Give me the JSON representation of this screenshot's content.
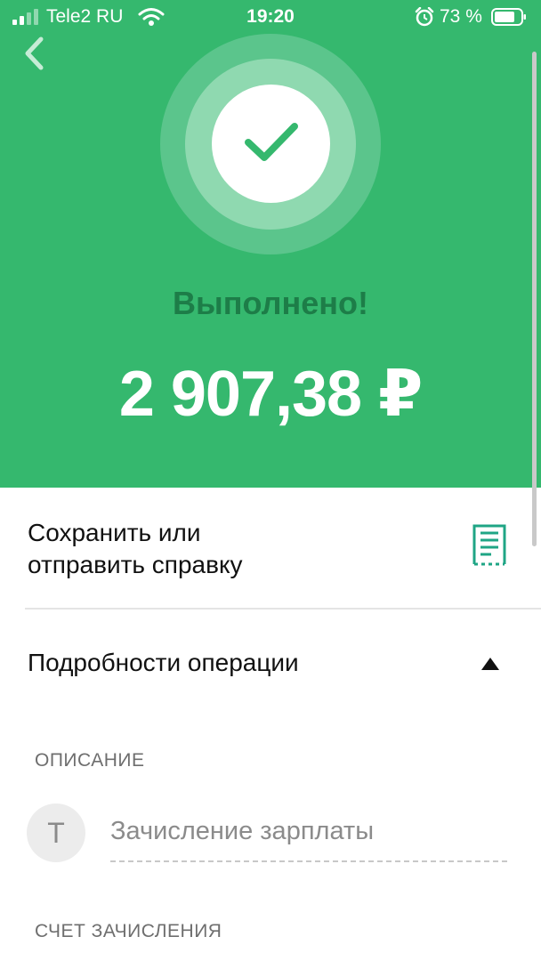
{
  "status_bar": {
    "carrier": "Tele2 RU",
    "time": "19:20",
    "battery": "73 %"
  },
  "result": {
    "status": "Выполнено!",
    "amount": "2 907,38 ₽"
  },
  "actions": {
    "save_receipt": "Сохранить или\nотправить справку",
    "details_toggle": "Подробности операции"
  },
  "details": {
    "description_label": "ОПИСАНИЕ",
    "avatar_letter": "Т",
    "description_value": "Зачисление зарплаты",
    "account_label": "СЧЕТ ЗАЧИСЛЕНИЯ"
  },
  "colors": {
    "hero_green": "#35b86e",
    "status_text_green": "#1d7d48",
    "accent_teal": "#1fa585"
  }
}
